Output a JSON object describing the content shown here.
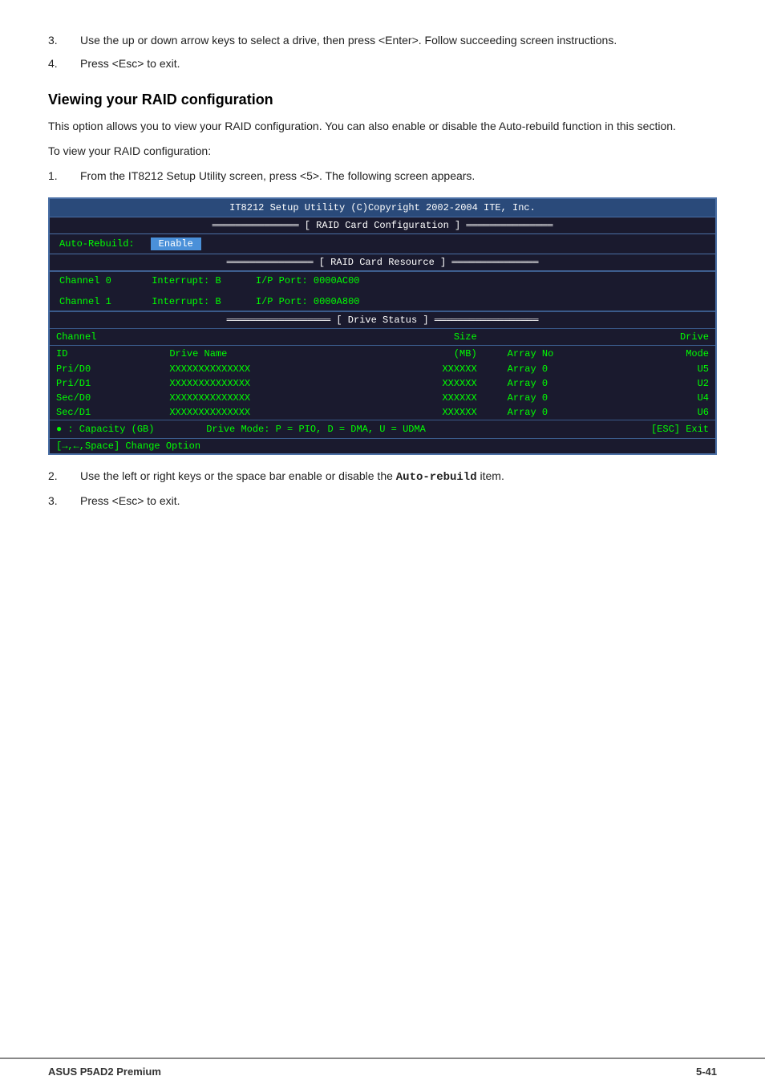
{
  "page": {
    "footer_left": "ASUS P5AD2 Premium",
    "footer_right": "5-41"
  },
  "list_items_top": [
    {
      "num": "3.",
      "text": "Use the up or down arrow keys to select a drive, then press <Enter>. Follow succeeding screen instructions."
    },
    {
      "num": "4.",
      "text": "Press <Esc> to exit."
    }
  ],
  "section": {
    "title": "Viewing your RAID configuration",
    "para1": "This option allows you to view your RAID configuration. You can also enable or disable the Auto-rebuild function in this section.",
    "para2": "To view your RAID configuration:",
    "step1_num": "1.",
    "step1_text": "From the IT8212 Setup Utility screen, press <5>. The following screen appears."
  },
  "terminal": {
    "header": "IT8212 Setup Utility (C)Copyright 2002-2004 ITE, Inc.",
    "raid_config_title": "[ RAID Card Configuration ]",
    "auto_rebuild_label": "Auto-Rebuild:",
    "auto_rebuild_value": "Enable",
    "raid_resource_title": "[ RAID Card Resource ]",
    "channels": [
      {
        "label": "Channel 0",
        "interrupt": "Interrupt: B",
        "port": "I/P Port: 0000AC00"
      },
      {
        "label": "Channel 1",
        "interrupt": "Interrupt: B",
        "port": "I/P Port: 0000A800"
      }
    ],
    "drive_status_title": "[ Drive Status ]",
    "drive_table_headers": [
      "Channel",
      "",
      "Size",
      "",
      "Drive"
    ],
    "drive_table_subheaders": [
      "ID",
      "Drive Name",
      "(MB)",
      "Array No",
      "Mode"
    ],
    "drives": [
      {
        "id": "Pri/D0",
        "name": "XXXXXXXXXXXXXX",
        "size": "XXXXXX",
        "array": "Array 0",
        "mode": "U5"
      },
      {
        "id": "Pri/D1",
        "name": "XXXXXXXXXXXXXX",
        "size": "XXXXXX",
        "array": "Array 0",
        "mode": "U2"
      },
      {
        "id": "Sec/D0",
        "name": "XXXXXXXXXXXXXX",
        "size": "XXXXXX",
        "array": "Array 0",
        "mode": "U4"
      },
      {
        "id": "Sec/D1",
        "name": "XXXXXXXXXXXXXX",
        "size": "XXXXXX",
        "array": "Array 0",
        "mode": "U6"
      }
    ],
    "footer_left": "● : Capacity (GB)          Drive Mode: P = PIO, D = DMA, U = UDMA",
    "footer_right": "[→,←,Space] Change Option                                    [ESC] Exit"
  },
  "list_items_bottom": [
    {
      "num": "2.",
      "text": "Use the left or right keys or the space bar enable or disable the Auto-rebuild item."
    },
    {
      "num": "3.",
      "text": "Press <Esc> to exit."
    }
  ]
}
